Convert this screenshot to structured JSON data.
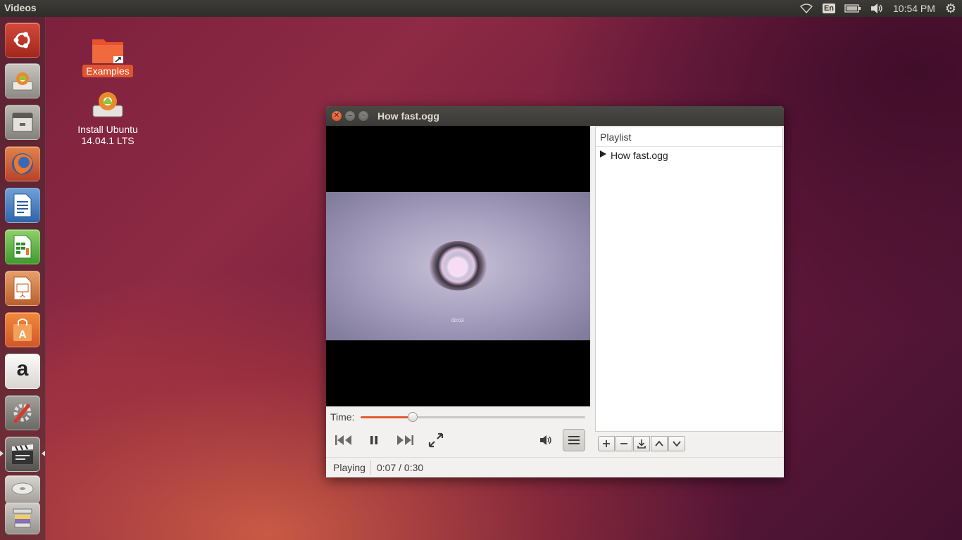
{
  "top_panel": {
    "app_title": "Videos",
    "keyboard_layout": "En",
    "clock": "10:54 PM",
    "icons": [
      "wifi-icon",
      "battery-icon",
      "volume-icon",
      "gear-icon"
    ]
  },
  "launcher": {
    "items": [
      {
        "name": "dash-home",
        "icon": "ubuntu-logo-icon"
      },
      {
        "name": "install-ubuntu",
        "icon": "installer-icon"
      },
      {
        "name": "files",
        "icon": "file-cabinet-icon"
      },
      {
        "name": "firefox",
        "icon": "firefox-icon"
      },
      {
        "name": "libreoffice-writer",
        "icon": "writer-icon"
      },
      {
        "name": "libreoffice-calc",
        "icon": "calc-icon"
      },
      {
        "name": "libreoffice-impress",
        "icon": "impress-icon"
      },
      {
        "name": "ubuntu-software-center",
        "icon": "shopping-bag-icon"
      },
      {
        "name": "amazon",
        "icon": "amazon-icon",
        "glyph": "a"
      },
      {
        "name": "system-settings",
        "icon": "settings-wrench-icon"
      },
      {
        "name": "videos",
        "icon": "clapperboard-icon"
      },
      {
        "name": "removable-drive",
        "icon": "drive-icon"
      },
      {
        "name": "trash",
        "icon": "trash-icon"
      }
    ]
  },
  "desktop": {
    "icons": [
      {
        "label": "Examples"
      },
      {
        "label_line1": "Install Ubuntu",
        "label_line2": "14.04.1 LTS"
      }
    ]
  },
  "window": {
    "title": "How fast.ogg",
    "video_timecode": "00:03",
    "time_label": "Time:",
    "progress": 0.233,
    "status_state": "Playing",
    "status_time": "0:07 / 0:30",
    "playlist": {
      "title": "Playlist",
      "items": [
        {
          "label": "How fast.ogg",
          "playing": true
        }
      ],
      "toolbar": [
        "add-icon",
        "remove-icon",
        "save-icon",
        "move-up-icon",
        "move-down-icon"
      ]
    }
  },
  "colors": {
    "accent": "#e25b2e",
    "panel": "#3c3b37",
    "window_bg": "#f2f1f0"
  }
}
